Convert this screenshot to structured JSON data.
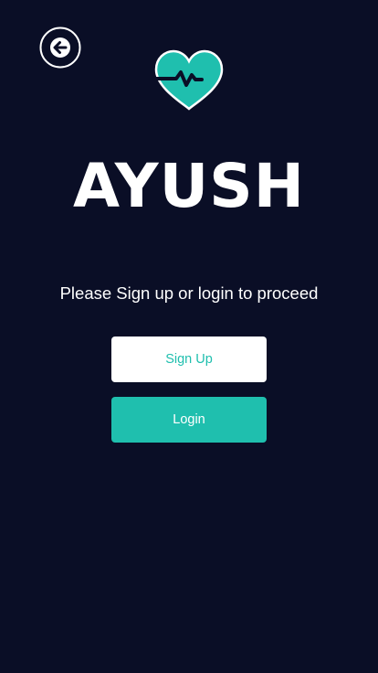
{
  "header": {
    "back_icon": "arrow-left-circle-icon",
    "logo_icon": "heart-pulse-icon"
  },
  "brand": {
    "title": "AYUSH"
  },
  "auth": {
    "prompt": "Please Sign up or login to proceed",
    "signup_label": "Sign Up",
    "login_label": "Login"
  },
  "colors": {
    "background": "#0a0e26",
    "accent": "#1fbfae",
    "text": "#ffffff"
  }
}
